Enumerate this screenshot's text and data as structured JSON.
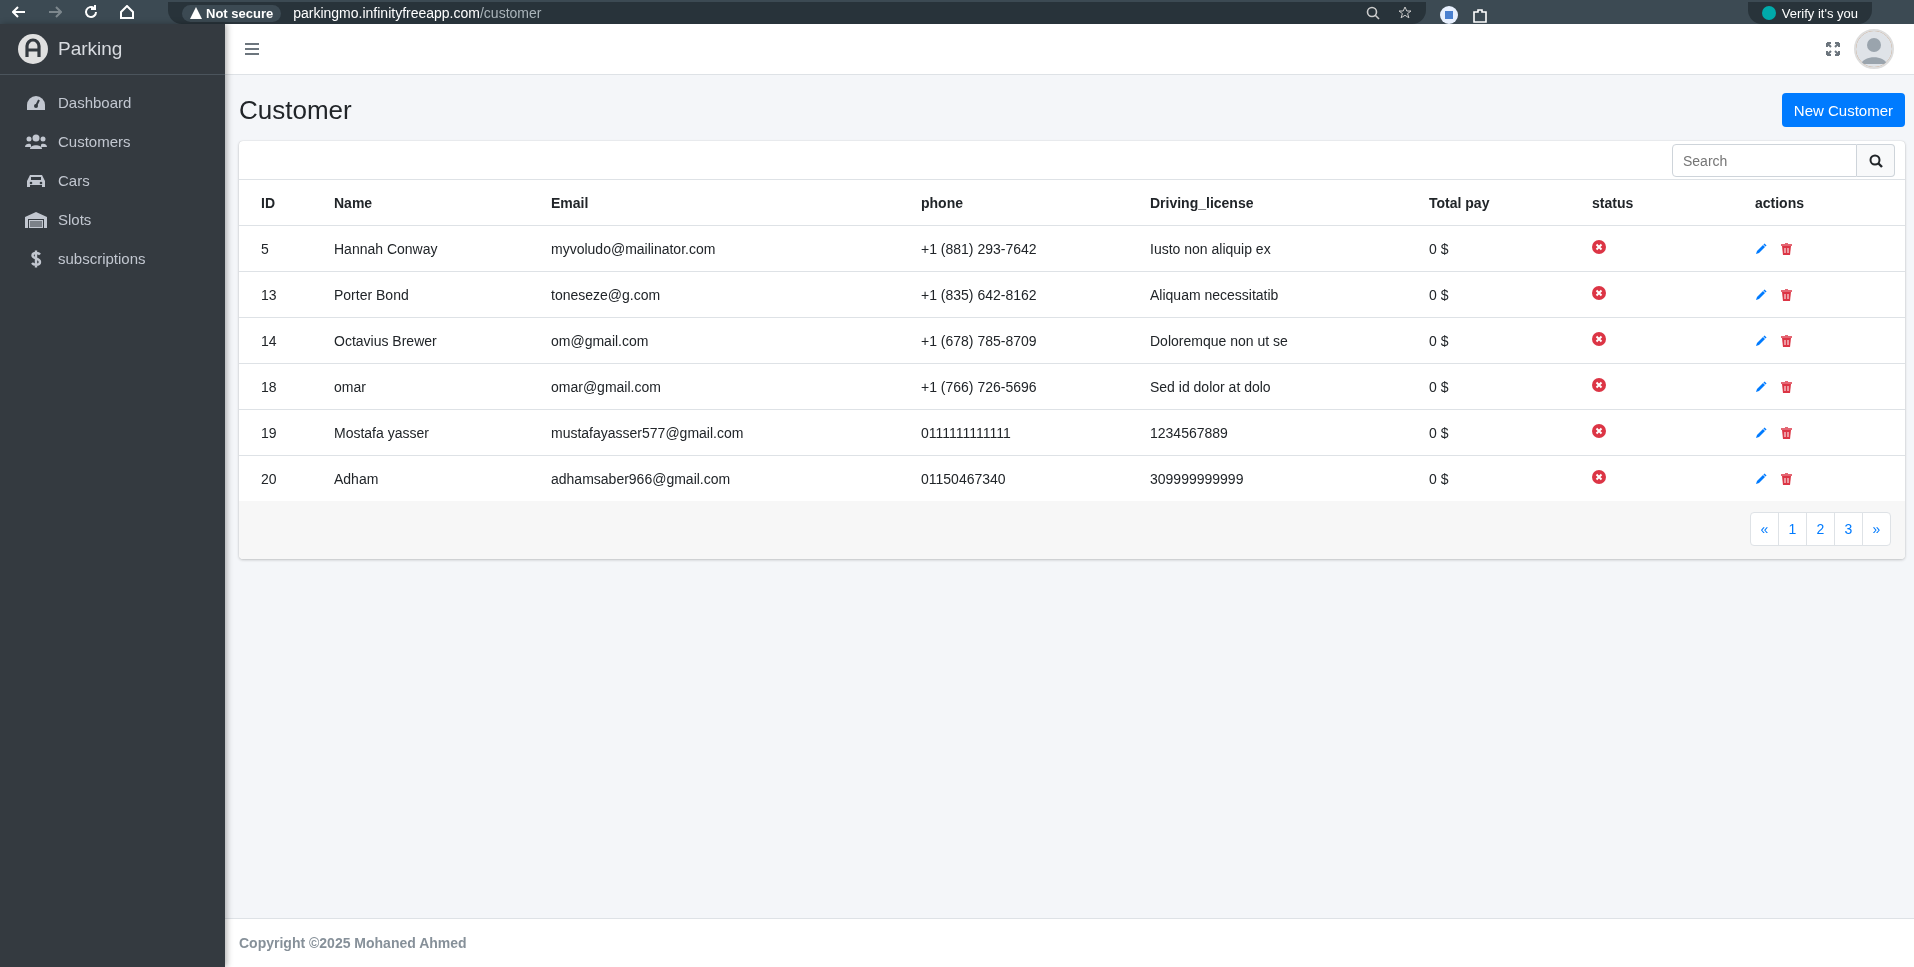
{
  "browser": {
    "security": "Not secure",
    "url_host": "parkingmo.infinityfreeapp.com",
    "url_path": "/customer",
    "profile": "Verify it's you"
  },
  "sidebar": {
    "brand": "Parking",
    "items": [
      {
        "label": "Dashboard"
      },
      {
        "label": "Customers"
      },
      {
        "label": "Cars"
      },
      {
        "label": "Slots"
      },
      {
        "label": "subscriptions"
      }
    ]
  },
  "page": {
    "title": "Customer",
    "new_button": "New Customer"
  },
  "search": {
    "placeholder": "Search"
  },
  "table": {
    "columns": [
      "ID",
      "Name",
      "Email",
      "phone",
      "Driving_license",
      "Total pay",
      "status",
      "actions"
    ],
    "rows": [
      {
        "id": "5",
        "name": "Hannah Conway",
        "email": "myvoludo@mailinator.com",
        "phone": "+1 (881) 293-7642",
        "driving_license": "Iusto non aliquip ex",
        "total_pay": "0 $",
        "active": false
      },
      {
        "id": "13",
        "name": "Porter Bond",
        "email": "toneseze@g.com",
        "phone": "+1 (835) 642-8162",
        "driving_license": "Aliquam necessitatib",
        "total_pay": "0 $",
        "active": false
      },
      {
        "id": "14",
        "name": "Octavius Brewer",
        "email": "om@gmail.com",
        "phone": "+1 (678) 785-8709",
        "driving_license": "Doloremque non ut se",
        "total_pay": "0 $",
        "active": false
      },
      {
        "id": "18",
        "name": "omar",
        "email": "omar@gmail.com",
        "phone": "+1 (766) 726-5696",
        "driving_license": "Sed id dolor at dolo",
        "total_pay": "0 $",
        "active": false
      },
      {
        "id": "19",
        "name": "Mostafa yasser",
        "email": "mustafayasser577@gmail.com",
        "phone": "0111111111111",
        "driving_license": "1234567889",
        "total_pay": "0 $",
        "active": false
      },
      {
        "id": "20",
        "name": "Adham",
        "email": "adhamsaber966@gmail.com",
        "phone": "01150467340",
        "driving_license": "309999999999",
        "total_pay": "0 $",
        "active": false
      }
    ]
  },
  "pagination": [
    "«",
    "1",
    "2",
    "3",
    "»"
  ],
  "footer": "Copyright ©2025 Mohaned Ahmed"
}
